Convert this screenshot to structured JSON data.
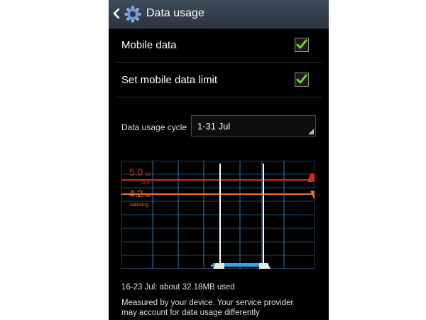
{
  "header": {
    "title": "Data usage",
    "back_icon": "back-chevron-icon",
    "app_icon": "gear-icon"
  },
  "settings": [
    {
      "label": "Mobile data",
      "checked": true
    },
    {
      "label": "Set mobile data limit",
      "checked": true
    }
  ],
  "cycle": {
    "label": "Data usage cycle",
    "value": "1-31 Jul"
  },
  "chart": {
    "limit": {
      "value": "5.0",
      "unit": "GB",
      "label": "limit",
      "color": "#d42a1e"
    },
    "warning": {
      "value": "4.2",
      "unit": "GB",
      "label": "warning",
      "color": "#e5761c"
    },
    "usage_color": "#33a7e6",
    "grid_color": "#2e79a8"
  },
  "summary": {
    "range_text": "16-23 Jul: about 32.18MB used",
    "note_line1": "Measured by your device. Your service provider",
    "note_line2": "may account for data usage differently"
  }
}
